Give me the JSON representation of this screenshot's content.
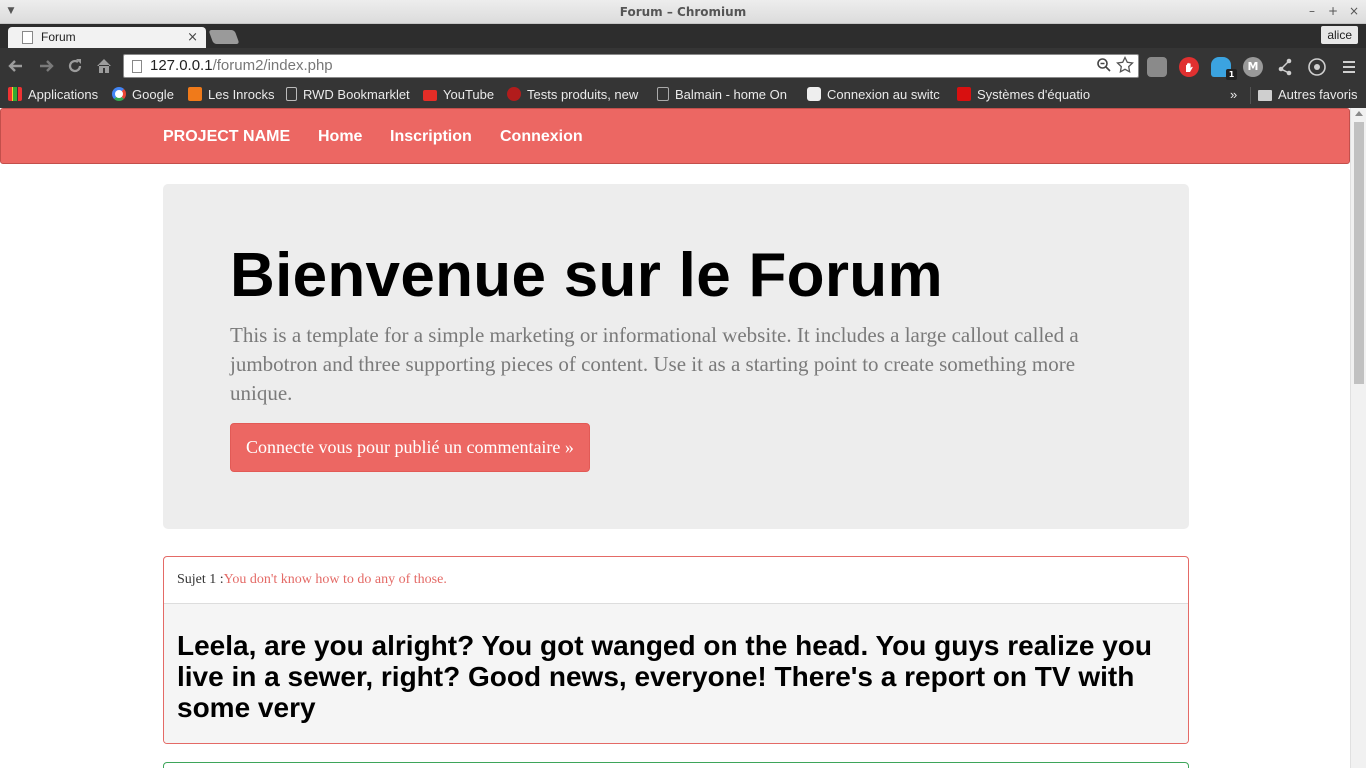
{
  "window": {
    "title": "Forum – Chromium",
    "minimize_glyph": "–",
    "maximize_glyph": "+",
    "close_glyph": "×"
  },
  "tab": {
    "title": "Forum",
    "close_glyph": "×",
    "profile_name": "alice"
  },
  "omnibox": {
    "host": "127.0.0.1",
    "path": "/forum2/index.php"
  },
  "bookmarks": {
    "items": [
      {
        "label": "Applications",
        "color": "#e0a030"
      },
      {
        "label": "Google",
        "color": "#ffffff"
      },
      {
        "label": "Les Inrocks",
        "color": "#f07a1a"
      },
      {
        "label": "RWD Bookmarklet",
        "color": "#d8d8d8"
      },
      {
        "label": "YouTube",
        "color": "#e52d27"
      },
      {
        "label": "Tests produits, new",
        "color": "#b21c1c"
      },
      {
        "label": "Balmain - home On",
        "color": "#222222"
      },
      {
        "label": "Connexion au switc",
        "color": "#ffffff"
      },
      {
        "label": "Systèmes d'équatio",
        "color": "#d81010"
      }
    ],
    "more_glyph": "»",
    "other_label": "Autres favoris"
  },
  "extensions": [
    {
      "name": "camera-ext-icon",
      "color": "#8a8a8a",
      "glyph": ""
    },
    {
      "name": "adblock-ext-icon",
      "color": "#e03030",
      "glyph": ""
    },
    {
      "name": "ghostery-ext-icon",
      "color": "#3ba3e0",
      "glyph": ""
    },
    {
      "name": "m-ext-icon",
      "color": "#9a9a9a",
      "glyph": "M"
    },
    {
      "name": "share-ext-icon",
      "color": "#555555",
      "glyph": ""
    },
    {
      "name": "radar-ext-icon",
      "color": "#666666",
      "glyph": ""
    }
  ],
  "ghostery_badge": "1",
  "site": {
    "brand": "PROJECT NAME",
    "nav": [
      "Home",
      "Inscription",
      "Connexion"
    ],
    "accent": "#ec6763"
  },
  "jumbotron": {
    "heading": "Bienvenue sur le Forum",
    "lead": "This is a template for a simple marketing or informational website. It includes a large callout called a jumbotron and three supporting pieces of content. Use it as a starting point to create something more unique.",
    "cta": "Connecte vous pour publié un commentaire »"
  },
  "posts": [
    {
      "prefix": "Sujet 1 :",
      "subject": "You don't know how to do any of those.",
      "body": "Leela, are you alright? You got wanged on the head. You guys realize you live in a sewer, right? Good news, everyone! There's a report on TV with some very"
    }
  ]
}
